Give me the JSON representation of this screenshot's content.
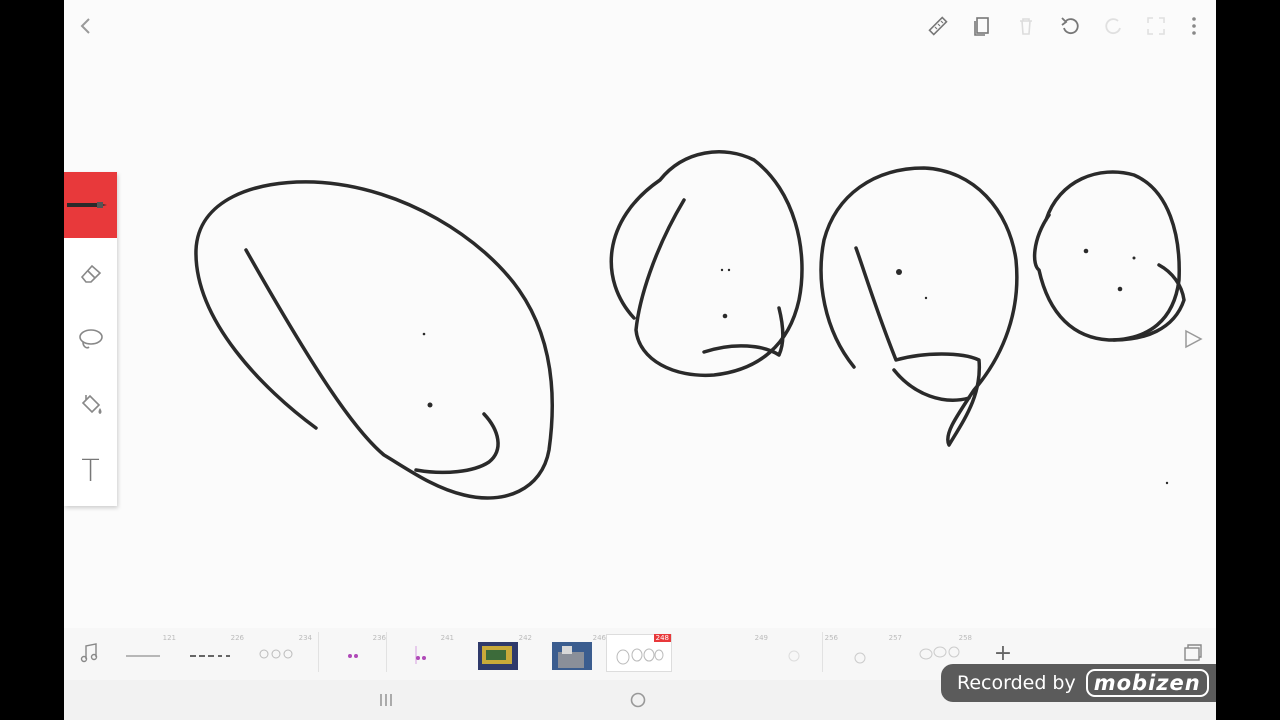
{
  "app": {
    "accent_color": "#e8393b",
    "canvas_background": "#fbfbfb"
  },
  "top_toolbar": {
    "items": [
      {
        "name": "back",
        "icon": "chevron-left-icon"
      },
      {
        "name": "ruler",
        "icon": "ruler-icon"
      },
      {
        "name": "frames",
        "icon": "copy-frames-icon"
      },
      {
        "name": "delete",
        "icon": "trash-icon"
      },
      {
        "name": "undo",
        "icon": "undo-icon"
      },
      {
        "name": "redo",
        "icon": "redo-icon"
      },
      {
        "name": "fullscreen",
        "icon": "expand-icon"
      },
      {
        "name": "menu",
        "icon": "more-vertical-icon"
      }
    ]
  },
  "tools": [
    {
      "name": "brush",
      "icon": "brush-icon",
      "active": true
    },
    {
      "name": "eraser",
      "icon": "eraser-icon",
      "active": false
    },
    {
      "name": "lasso",
      "icon": "lasso-icon",
      "active": false
    },
    {
      "name": "fill",
      "icon": "paint-bucket-icon",
      "active": false
    },
    {
      "name": "text",
      "icon": "text-tool-icon",
      "active": false,
      "label": "T"
    }
  ],
  "timeline": {
    "frames": [
      {
        "number": "121"
      },
      {
        "number": "226"
      },
      {
        "number": "234"
      },
      {
        "number": "236"
      },
      {
        "number": "241"
      },
      {
        "number": "242"
      },
      {
        "number": "246"
      },
      {
        "number": "248"
      },
      {
        "number": "249"
      },
      {
        "number": "256"
      },
      {
        "number": "257"
      },
      {
        "number": "258"
      }
    ],
    "selected_frame": "248",
    "add_label": "+"
  },
  "watermark": {
    "text": "Recorded by",
    "logo": "mobizen"
  }
}
